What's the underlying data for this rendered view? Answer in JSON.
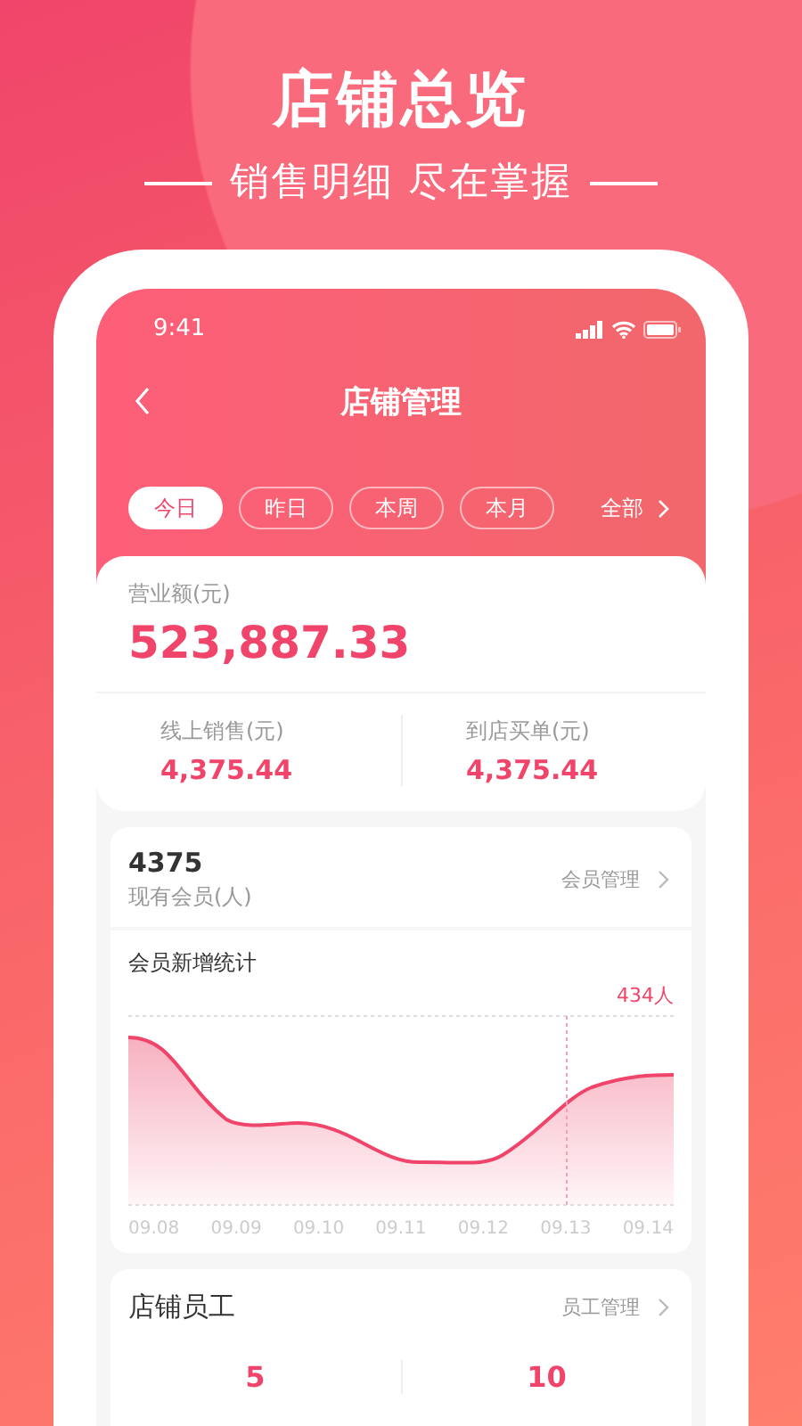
{
  "banner": {
    "title": "店铺总览",
    "subtitle": "销售明细 尽在掌握"
  },
  "status_bar": {
    "time": "9:41"
  },
  "nav": {
    "title": "店铺管理"
  },
  "period_tabs": [
    {
      "label": "今日",
      "selected": true
    },
    {
      "label": "昨日",
      "selected": false
    },
    {
      "label": "本周",
      "selected": false
    },
    {
      "label": "本月",
      "selected": false
    }
  ],
  "period_more": "全部",
  "revenue": {
    "label": "营业额(元)",
    "value": "523,887.33"
  },
  "breakdown": [
    {
      "label": "线上销售(元)",
      "value": "4,375.44"
    },
    {
      "label": "到店买单(元)",
      "value": "4,375.44"
    }
  ],
  "members": {
    "count": "4375",
    "label": "现有会员(人)",
    "link": "会员管理",
    "chart_title": "会员新增统计",
    "highlight": "434人",
    "x_labels": [
      "09.08",
      "09.09",
      "09.10",
      "09.11",
      "09.12",
      "09.13",
      "09.14"
    ]
  },
  "staff": {
    "title": "店铺员工",
    "link": "员工管理",
    "stats": [
      {
        "value": "5"
      },
      {
        "value": "10"
      }
    ]
  }
}
